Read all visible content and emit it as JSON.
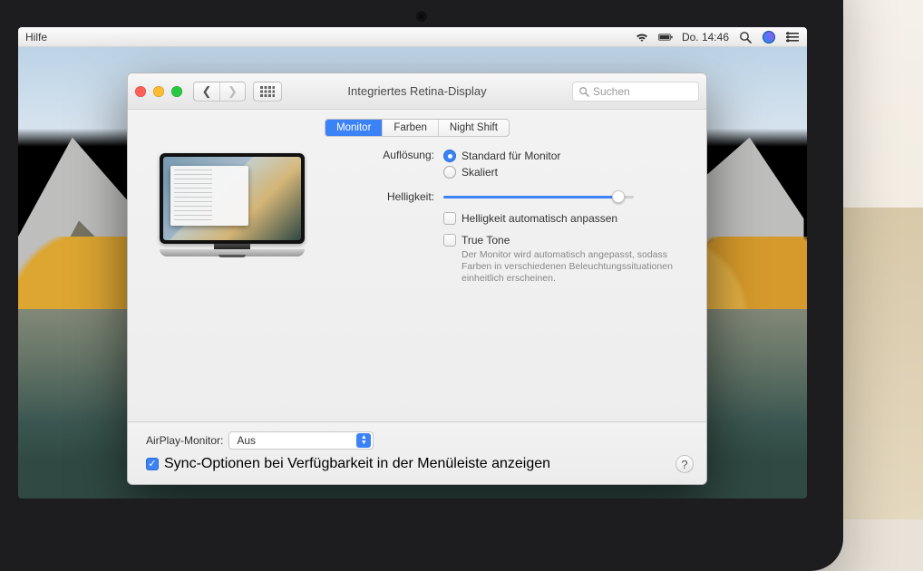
{
  "menubar": {
    "menu_label": "Hilfe",
    "clock": "Do. 14:46"
  },
  "window": {
    "title": "Integriertes Retina-Display",
    "search_placeholder": "Suchen",
    "tabs": [
      "Monitor",
      "Farben",
      "Night Shift"
    ],
    "active_tab": 0,
    "resolution_label": "Auflösung:",
    "resolution_options": {
      "standard": "Standard für Monitor",
      "scaled": "Skaliert"
    },
    "resolution_selected": "standard",
    "brightness_label": "Helligkeit:",
    "brightness_value": 92,
    "auto_brightness_label": "Helligkeit automatisch anpassen",
    "auto_brightness_checked": false,
    "true_tone_label": "True Tone",
    "true_tone_checked": false,
    "true_tone_hint": "Der Monitor wird automatisch angepasst, sodass Farben in verschiedenen Beleuchtungssituationen einheitlich erscheinen.",
    "airplay_label": "AirPlay-Monitor:",
    "airplay_value": "Aus",
    "sync_label": "Sync-Optionen bei Verfügbarkeit in der Menüleiste anzeigen",
    "sync_checked": true
  }
}
